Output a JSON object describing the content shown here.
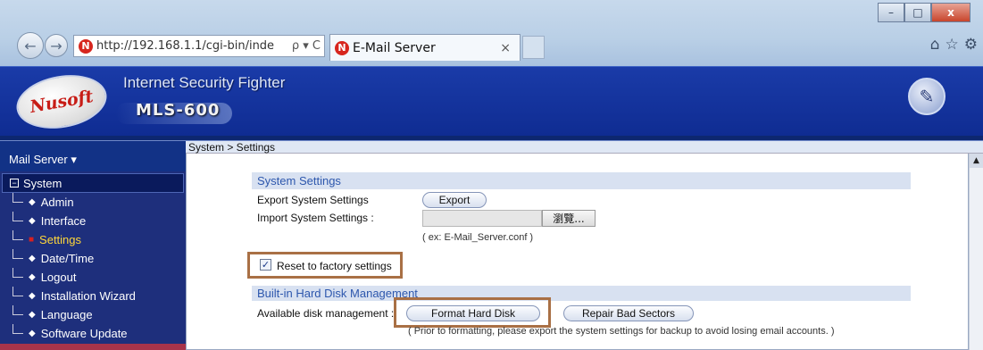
{
  "browser": {
    "url": "http://192.168.1.1/cgi-bin/inde",
    "address_tools": "ρ ▾ C",
    "tab_title": "E-Mail Server",
    "tab_close": "×",
    "window_min": "–",
    "window_max": "□",
    "window_close": "x",
    "home_icon": "⌂",
    "star_icon": "☆",
    "gear_icon": "⚙",
    "favicon": "N"
  },
  "header": {
    "logo_text": "Nusoft",
    "product_line": "Internet Security Fighter",
    "model": "MLS-600"
  },
  "sidebar": {
    "menu_title": "Mail Server ▾",
    "system_group": "System",
    "items": [
      {
        "label": "Admin",
        "active": false
      },
      {
        "label": "Interface",
        "active": false
      },
      {
        "label": "Settings",
        "active": true
      },
      {
        "label": "Date/Time",
        "active": false
      },
      {
        "label": "Logout",
        "active": false
      },
      {
        "label": "Installation Wizard",
        "active": false
      },
      {
        "label": "Language",
        "active": false
      },
      {
        "label": "Software Update",
        "active": false
      }
    ]
  },
  "content": {
    "breadcrumb": "System > Settings",
    "system_settings": {
      "title": "System Settings",
      "export_label": "Export System Settings",
      "export_button": "Export",
      "import_label": "Import System Settings :",
      "browse_button": "瀏覽...",
      "import_hint": "( ex: E-Mail_Server.conf )",
      "reset_label": "Reset to factory settings",
      "reset_checked": true
    },
    "disk": {
      "title": "Built-in Hard Disk Management",
      "available_label": "Available disk management :",
      "format_button": "Format Hard Disk",
      "repair_button": "Repair Bad Sectors",
      "note": "( Prior to formatting, please export the system settings for backup to avoid losing email accounts. )"
    }
  },
  "colors": {
    "header_blue": "#1a3ba8",
    "sidebar_blue": "#1e2f7c",
    "section_bar": "#d8e1f1",
    "highlight_box": "#a97045",
    "active_item": "#ffd73a"
  }
}
